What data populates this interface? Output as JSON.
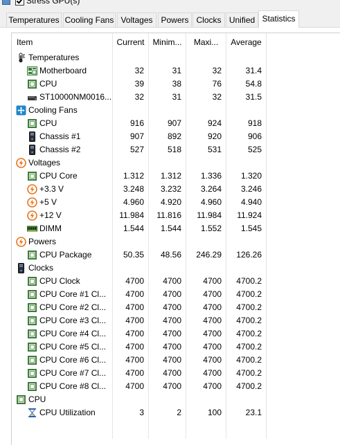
{
  "window": {
    "stress_gpu_label": "Stress GPU(s)"
  },
  "tabs": [
    {
      "label": "Temperatures",
      "active": false
    },
    {
      "label": "Cooling Fans",
      "active": false
    },
    {
      "label": "Voltages",
      "active": false
    },
    {
      "label": "Powers",
      "active": false
    },
    {
      "label": "Clocks",
      "active": false
    },
    {
      "label": "Unified",
      "active": false
    },
    {
      "label": "Statistics",
      "active": true
    }
  ],
  "table": {
    "columns": [
      "Item",
      "Current",
      "Minim...",
      "Maxi...",
      "Average"
    ],
    "groups": [
      {
        "label": "Temperatures",
        "icon": "thermometer-icon",
        "rows": [
          {
            "label": "Motherboard",
            "icon": "motherboard-icon",
            "current": "32",
            "min": "31",
            "max": "32",
            "avg": "31.4"
          },
          {
            "label": "CPU",
            "icon": "cpu-chip-icon",
            "current": "39",
            "min": "38",
            "max": "76",
            "avg": "54.8"
          },
          {
            "label": "ST10000NM0016...",
            "icon": "hard-drive-icon",
            "current": "32",
            "min": "31",
            "max": "32",
            "avg": "31.5"
          }
        ]
      },
      {
        "label": "Cooling Fans",
        "icon": "fan-icon",
        "rows": [
          {
            "label": "CPU",
            "icon": "cpu-chip-icon",
            "current": "916",
            "min": "907",
            "max": "924",
            "avg": "918"
          },
          {
            "label": "Chassis #1",
            "icon": "chassis-icon",
            "current": "907",
            "min": "892",
            "max": "920",
            "avg": "906"
          },
          {
            "label": "Chassis #2",
            "icon": "chassis-icon",
            "current": "527",
            "min": "518",
            "max": "531",
            "avg": "525"
          }
        ]
      },
      {
        "label": "Voltages",
        "icon": "voltage-icon",
        "rows": [
          {
            "label": "CPU Core",
            "icon": "cpu-chip-icon",
            "current": "1.312",
            "min": "1.312",
            "max": "1.336",
            "avg": "1.320"
          },
          {
            "label": "+3.3 V",
            "icon": "voltage-icon",
            "current": "3.248",
            "min": "3.232",
            "max": "3.264",
            "avg": "3.246"
          },
          {
            "label": "+5 V",
            "icon": "voltage-icon",
            "current": "4.960",
            "min": "4.920",
            "max": "4.960",
            "avg": "4.940"
          },
          {
            "label": "+12 V",
            "icon": "voltage-icon",
            "current": "11.984",
            "min": "11.816",
            "max": "11.984",
            "avg": "11.924"
          },
          {
            "label": "DIMM",
            "icon": "memory-module-icon",
            "current": "1.544",
            "min": "1.544",
            "max": "1.552",
            "avg": "1.545"
          }
        ]
      },
      {
        "label": "Powers",
        "icon": "voltage-icon",
        "rows": [
          {
            "label": "CPU Package",
            "icon": "cpu-chip-icon",
            "current": "50.35",
            "min": "48.56",
            "max": "246.29",
            "avg": "126.26"
          }
        ]
      },
      {
        "label": "Clocks",
        "icon": "chassis-icon",
        "rows": [
          {
            "label": "CPU Clock",
            "icon": "cpu-chip-icon",
            "current": "4700",
            "min": "4700",
            "max": "4700",
            "avg": "4700.2"
          },
          {
            "label": "CPU Core #1 Cl...",
            "icon": "cpu-chip-icon",
            "current": "4700",
            "min": "4700",
            "max": "4700",
            "avg": "4700.2"
          },
          {
            "label": "CPU Core #2 Cl...",
            "icon": "cpu-chip-icon",
            "current": "4700",
            "min": "4700",
            "max": "4700",
            "avg": "4700.2"
          },
          {
            "label": "CPU Core #3 Cl...",
            "icon": "cpu-chip-icon",
            "current": "4700",
            "min": "4700",
            "max": "4700",
            "avg": "4700.2"
          },
          {
            "label": "CPU Core #4 Cl...",
            "icon": "cpu-chip-icon",
            "current": "4700",
            "min": "4700",
            "max": "4700",
            "avg": "4700.2"
          },
          {
            "label": "CPU Core #5 Cl...",
            "icon": "cpu-chip-icon",
            "current": "4700",
            "min": "4700",
            "max": "4700",
            "avg": "4700.2"
          },
          {
            "label": "CPU Core #6 Cl...",
            "icon": "cpu-chip-icon",
            "current": "4700",
            "min": "4700",
            "max": "4700",
            "avg": "4700.2"
          },
          {
            "label": "CPU Core #7 Cl...",
            "icon": "cpu-chip-icon",
            "current": "4700",
            "min": "4700",
            "max": "4700",
            "avg": "4700.2"
          },
          {
            "label": "CPU Core #8 Cl...",
            "icon": "cpu-chip-icon",
            "current": "4700",
            "min": "4700",
            "max": "4700",
            "avg": "4700.2"
          }
        ]
      },
      {
        "label": "CPU",
        "icon": "cpu-chip-icon",
        "rows": [
          {
            "label": "CPU Utilization",
            "icon": "hourglass-icon",
            "current": "3",
            "min": "2",
            "max": "100",
            "avg": "23.1"
          }
        ]
      }
    ]
  },
  "colors": {
    "chip_green": "#3b7a3b",
    "fan_blue": "#1f86c8",
    "volt_orange": "#e8731a",
    "drive_dark": "#3a3a3a",
    "hourglass_blue": "#2a5fa8"
  }
}
